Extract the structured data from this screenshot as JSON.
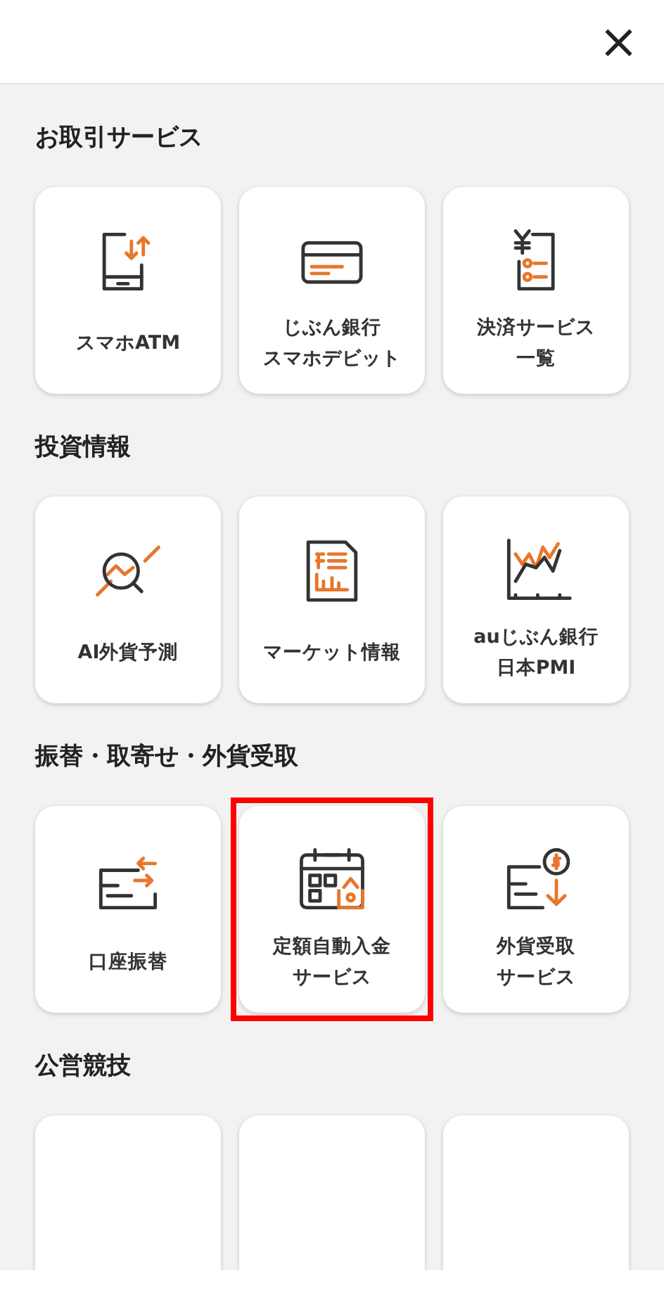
{
  "close_button": "×",
  "sections": [
    {
      "title": "お取引サービス",
      "items": [
        {
          "kind": "tile",
          "label": [
            "スマホATM"
          ],
          "highlighted": false
        },
        {
          "kind": "tile",
          "label": [
            "じぶん銀行",
            "スマホデビット"
          ],
          "highlighted": false
        },
        {
          "kind": "tile",
          "label": [
            "決済サービス",
            "一覧"
          ],
          "highlighted": false
        }
      ]
    },
    {
      "title": "投資情報",
      "items": [
        {
          "kind": "tile",
          "label": [
            "AI外貨予測"
          ],
          "highlighted": false
        },
        {
          "kind": "tile",
          "label": [
            "マーケット情報"
          ],
          "highlighted": false
        },
        {
          "kind": "tile",
          "label": [
            "auじぶん銀行",
            "日本PMI"
          ],
          "highlighted": false
        }
      ]
    },
    {
      "title": "振替・取寄せ・外貨受取",
      "items": [
        {
          "kind": "tile",
          "label": [
            "口座振替"
          ],
          "highlighted": false
        },
        {
          "kind": "tile",
          "label": [
            "定額自動入金",
            "サービス"
          ],
          "highlighted": true
        },
        {
          "kind": "tile",
          "label": [
            "外貨受取",
            "サービス"
          ],
          "highlighted": false
        }
      ]
    },
    {
      "title": "公営競技",
      "items": [
        {
          "kind": "cut"
        },
        {
          "kind": "cut"
        },
        {
          "kind": "cut"
        }
      ]
    }
  ]
}
